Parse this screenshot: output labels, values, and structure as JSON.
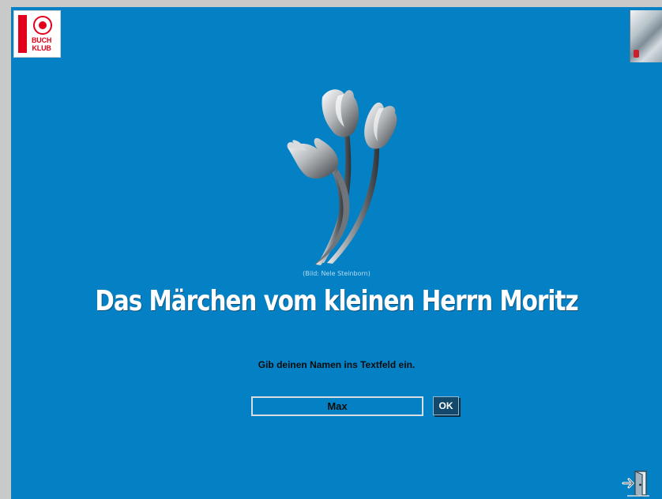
{
  "logo": {
    "text": "BUCH\nKLUB",
    "color": "#e2001a"
  },
  "image_credit": "(Bild: Nele Steinborn)",
  "title": "Das Märchen vom kleinen Herrn Moritz",
  "prompt": "Gib deinen Namen ins Textfeld ein.",
  "name_input": {
    "value": "Max"
  },
  "ok_button": {
    "label": "OK"
  },
  "exit_button": {
    "icon": "exit-door-icon"
  },
  "colors": {
    "background": "#0480c4",
    "title_text": "#ffffff",
    "button_bg": "#15496c"
  }
}
